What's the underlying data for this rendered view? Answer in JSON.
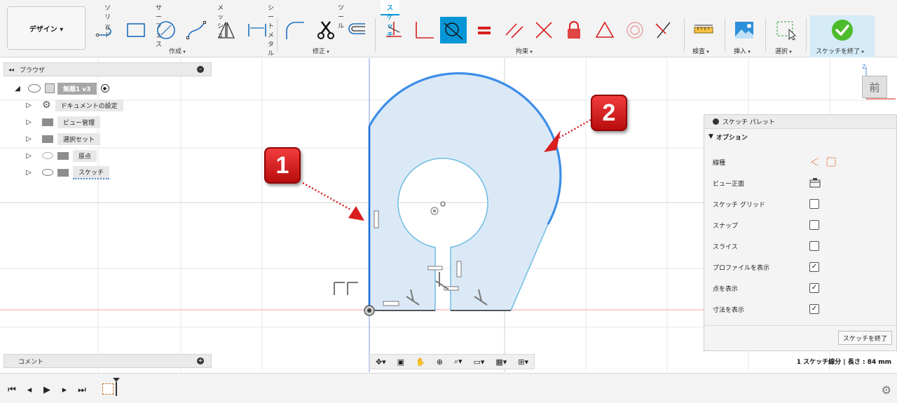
{
  "workspace": {
    "label": "デザイン ▾"
  },
  "tabs": [
    "ソリッド",
    "サーフェス",
    "メッシュ",
    "シートメタル",
    "ツール",
    "スケッチ"
  ],
  "groups": {
    "create": "作成",
    "modify": "修正",
    "constraints": "拘束",
    "inspect": "検査",
    "insert": "挿入",
    "select": "選択",
    "finish": "スケッチを終了"
  },
  "browser": {
    "title": "ブラウザ",
    "root": "無題1 v3",
    "items": [
      {
        "label": "ドキュメントの設定",
        "icon": "gear-icon"
      },
      {
        "label": "ビュー管理",
        "icon": "folder-icon"
      },
      {
        "label": "選択セット",
        "icon": "folder-icon"
      },
      {
        "label": "原点",
        "icon": "folder-icon"
      },
      {
        "label": "スケッチ",
        "icon": "folder-icon"
      }
    ]
  },
  "palette": {
    "title": "スケッチ パレット",
    "section": "オプション",
    "options": [
      {
        "label": "線種",
        "control": "linetype"
      },
      {
        "label": "ビュー正面",
        "control": "view"
      },
      {
        "label": "スケッチ グリッド",
        "checked": false
      },
      {
        "label": "スナップ",
        "checked": false
      },
      {
        "label": "スライス",
        "checked": false
      },
      {
        "label": "プロファイルを表示",
        "checked": true
      },
      {
        "label": "点を表示",
        "checked": true
      },
      {
        "label": "寸法を表示",
        "checked": true
      }
    ],
    "finish": "スケッチを終了"
  },
  "comment": {
    "label": "コメント"
  },
  "status": {
    "text": "1 スケッチ線分 | 長さ : 84 mm"
  },
  "viewcube": {
    "face": "前",
    "axis": "Z"
  },
  "callouts": [
    "1",
    "2"
  ],
  "colors": {
    "accent": "#0696d7",
    "callout": "#d81e1e",
    "profile": "#dbe9f7",
    "selected": "#3d8ee8"
  }
}
